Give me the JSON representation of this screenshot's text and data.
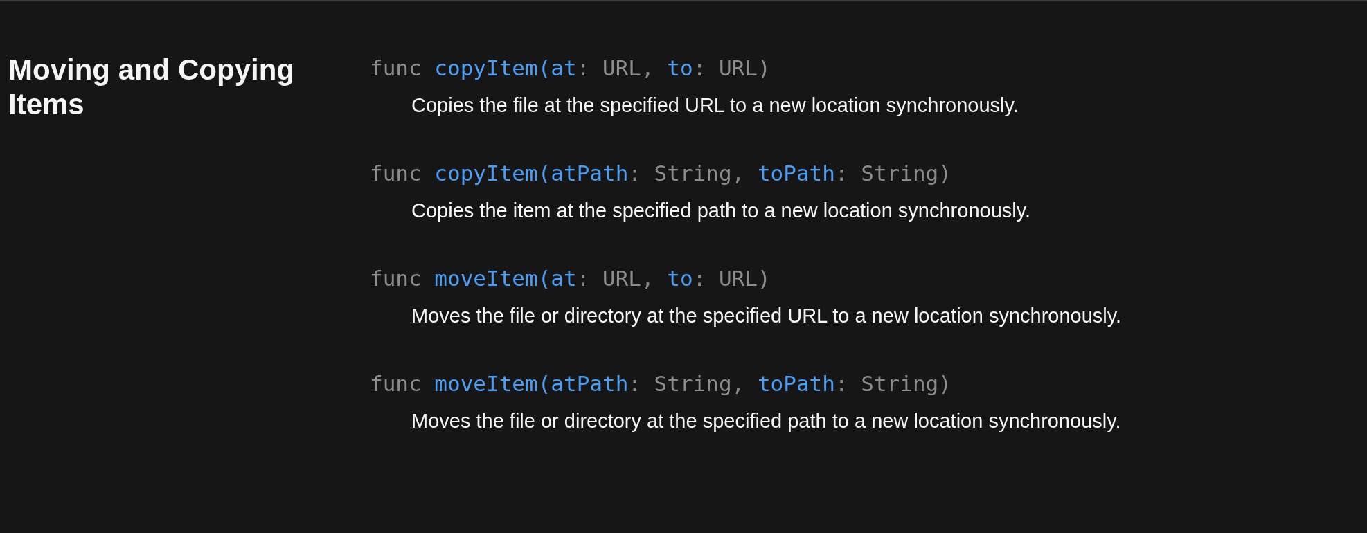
{
  "section": {
    "title": "Moving and Copying Items"
  },
  "symbols": [
    {
      "signature": [
        {
          "kind": "keyword",
          "text": "func "
        },
        {
          "kind": "name",
          "text": "copyItem("
        },
        {
          "kind": "param",
          "text": "at"
        },
        {
          "kind": "plain",
          "text": ": URL, "
        },
        {
          "kind": "param",
          "text": "to"
        },
        {
          "kind": "plain",
          "text": ": URL)"
        }
      ],
      "description": "Copies the file at the specified URL to a new location synchronously."
    },
    {
      "signature": [
        {
          "kind": "keyword",
          "text": "func "
        },
        {
          "kind": "name",
          "text": "copyItem("
        },
        {
          "kind": "param",
          "text": "atPath"
        },
        {
          "kind": "plain",
          "text": ": String, "
        },
        {
          "kind": "param",
          "text": "toPath"
        },
        {
          "kind": "plain",
          "text": ": String)"
        }
      ],
      "description": "Copies the item at the specified path to a new location synchronously."
    },
    {
      "signature": [
        {
          "kind": "keyword",
          "text": "func "
        },
        {
          "kind": "name",
          "text": "moveItem("
        },
        {
          "kind": "param",
          "text": "at"
        },
        {
          "kind": "plain",
          "text": ": URL, "
        },
        {
          "kind": "param",
          "text": "to"
        },
        {
          "kind": "plain",
          "text": ": URL)"
        }
      ],
      "description": "Moves the file or directory at the specified URL to a new location synchronously."
    },
    {
      "signature": [
        {
          "kind": "keyword",
          "text": "func "
        },
        {
          "kind": "name",
          "text": "moveItem("
        },
        {
          "kind": "param",
          "text": "atPath"
        },
        {
          "kind": "plain",
          "text": ": String, "
        },
        {
          "kind": "param",
          "text": "toPath"
        },
        {
          "kind": "plain",
          "text": ": String)"
        }
      ],
      "description": "Moves the file or directory at the specified path to a new location synchronously."
    }
  ]
}
